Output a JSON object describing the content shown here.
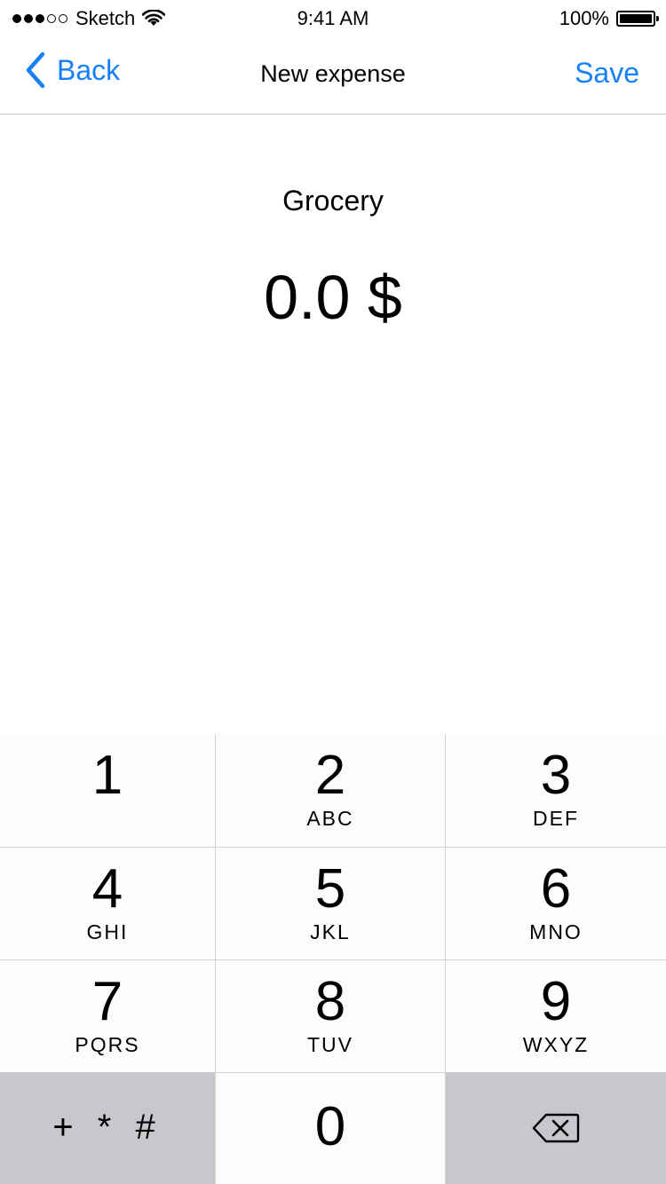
{
  "status_bar": {
    "carrier": "Sketch",
    "time": "9:41 AM",
    "battery": "100%",
    "signal_bars": 5,
    "signal_filled": 3
  },
  "nav": {
    "back_label": "Back",
    "title": "New expense",
    "save_label": "Save"
  },
  "content": {
    "category": "Grocery",
    "amount": "0.0 $"
  },
  "keypad": {
    "keys": [
      {
        "digit": "1",
        "letters": ""
      },
      {
        "digit": "2",
        "letters": "ABC"
      },
      {
        "digit": "3",
        "letters": "DEF"
      },
      {
        "digit": "4",
        "letters": "GHI"
      },
      {
        "digit": "5",
        "letters": "JKL"
      },
      {
        "digit": "6",
        "letters": "MNO"
      },
      {
        "digit": "7",
        "letters": "PQRS"
      },
      {
        "digit": "8",
        "letters": "TUV"
      },
      {
        "digit": "9",
        "letters": "WXYZ"
      }
    ],
    "symbols": "+ * #",
    "zero": "0"
  },
  "colors": {
    "accent": "#1680f8",
    "separator": "#c8c7cc",
    "dark_key": "#c6c8cc"
  },
  "icons": {
    "back": "chevron-left-icon",
    "wifi": "wifi-icon",
    "battery": "battery-icon",
    "delete": "backspace-icon"
  }
}
